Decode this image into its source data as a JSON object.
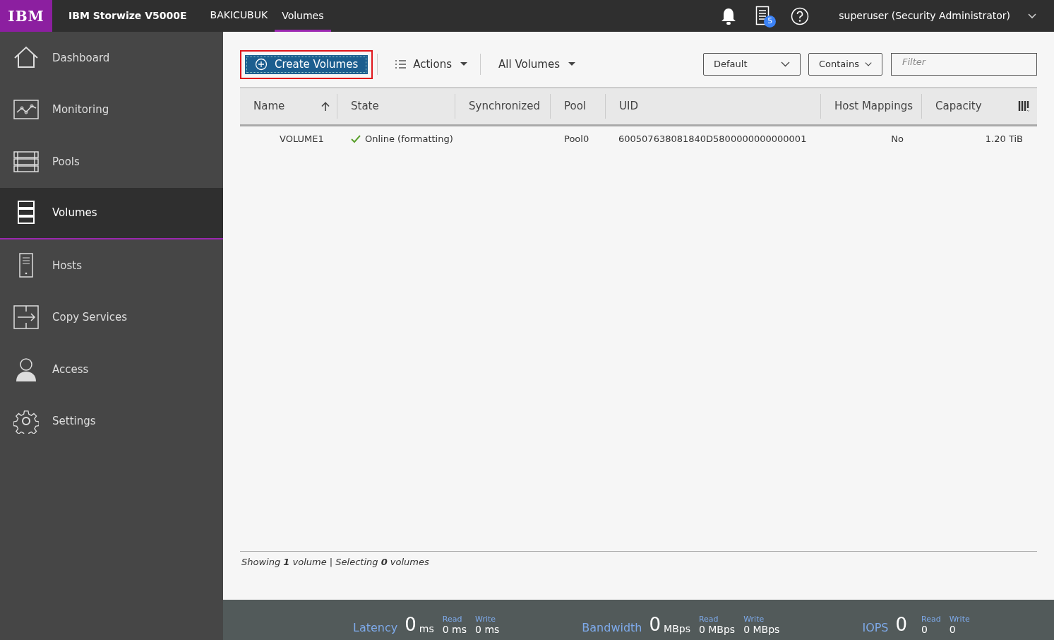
{
  "header": {
    "logo": "IBM",
    "product": "IBM Storwize V5000E",
    "nav": [
      {
        "label": "BAKICUBUK",
        "selected": false
      },
      {
        "label": "Volumes",
        "selected": true
      }
    ],
    "tasks_badge": "5",
    "user": "superuser (Security Administrator)"
  },
  "sidebar": {
    "items": [
      {
        "label": "Dashboard",
        "kind": "home",
        "selected": false
      },
      {
        "label": "Monitoring",
        "kind": "monitor",
        "selected": false
      },
      {
        "label": "Pools",
        "kind": "pools",
        "selected": false
      },
      {
        "label": "Volumes",
        "kind": "volumes",
        "selected": true
      },
      {
        "label": "Hosts",
        "kind": "hosts",
        "selected": false
      },
      {
        "label": "Copy Services",
        "kind": "copy",
        "selected": false
      },
      {
        "label": "Access",
        "kind": "access",
        "selected": false
      },
      {
        "label": "Settings",
        "kind": "settings",
        "selected": false
      }
    ]
  },
  "toolbar": {
    "create_button": "Create Volumes",
    "highlighted": true,
    "actions": "Actions",
    "view": "All Volumes",
    "filter_column": "Default",
    "filter_mode": "Contains",
    "filter": {
      "placeholder": "Filter"
    }
  },
  "table": {
    "columns": [
      {
        "label": "Name",
        "sorted": true
      },
      {
        "label": "State",
        "sorted": false
      },
      {
        "label": "Synchronized",
        "sorted": false
      },
      {
        "label": "Pool",
        "sorted": false
      },
      {
        "label": "UID",
        "sorted": false
      },
      {
        "label": "Host Mappings",
        "sorted": false
      },
      {
        "label": "Capacity",
        "sorted": false
      }
    ],
    "rows": [
      {
        "name": "VOLUME1",
        "state": "Online (formatting)",
        "online": true,
        "pool": "Pool0",
        "uid": "600507638081840D5800000000000001",
        "host_mappings": "No",
        "capacity": "1.20 TiB"
      }
    ]
  },
  "status": "Showing **1** volume | Selecting **0** volumes",
  "performance": [
    {
      "label": "Latency",
      "value": "0",
      "unit": "ms",
      "read_label": "Read",
      "read_value": "0 ms",
      "write_label": "Write",
      "write_value": "0 ms"
    },
    {
      "label": "Bandwidth",
      "value": "0",
      "unit": "MBps",
      "read_label": "Read",
      "read_value": "0 MBps",
      "write_label": "Write",
      "write_value": "0 MBps"
    },
    {
      "label": "IOPS",
      "value": "0",
      "read_label": "Read",
      "read_value": "0",
      "write_label": "Write",
      "write_value": "0"
    }
  ]
}
